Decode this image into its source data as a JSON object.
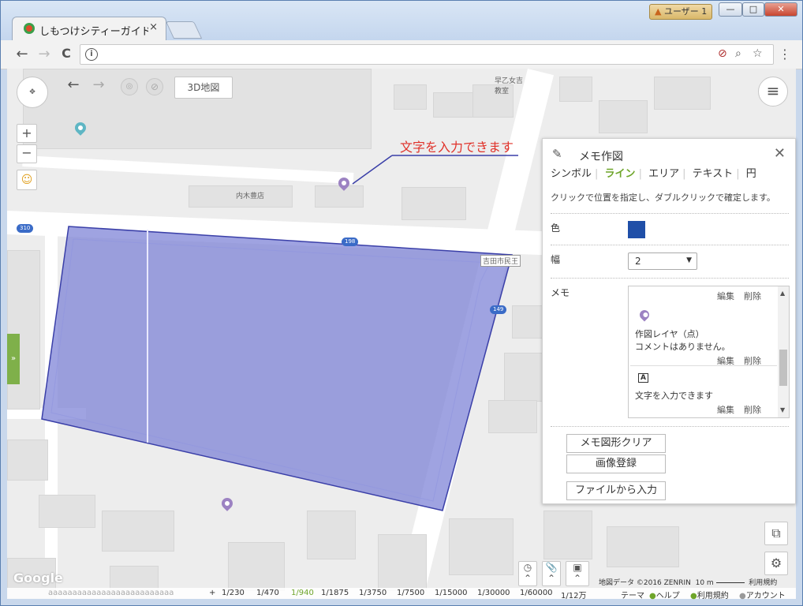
{
  "window": {
    "user_badge": "ユーザー 1",
    "min_label": "—",
    "max_label": "□",
    "close_label": "✕"
  },
  "tab": {
    "title": "しもつけシティーガイド",
    "close": "×"
  },
  "toolbar": {
    "back": "←",
    "forward": "→",
    "reload": "C",
    "info": "i",
    "block_icon": "⊘",
    "zoom_icon": "🔍",
    "star_icon": "☆",
    "menu": "⋮"
  },
  "map_controls": {
    "btn3d": "3D地図",
    "zoom_in": "+",
    "zoom_out": "−",
    "menu_icon": "≡",
    "sidebar_toggle": "»",
    "google": "Google"
  },
  "map_labels": {
    "annotation": "文字を入力できます",
    "store": "内木豊店",
    "facility": "早乙女吉\n教室",
    "route_310": "310",
    "route_198": "198",
    "route_149": "149",
    "city_office": "吉田市民王"
  },
  "panel": {
    "title": "メモ作図",
    "close": "✕",
    "tabs": [
      "シンボル",
      "ライン",
      "エリア",
      "テキスト",
      "円"
    ],
    "active_tab": "ライン",
    "hint": "クリックで位置を指定し、ダブルクリックで確定します。",
    "color_label": "色",
    "color_value": "#1f4fa8",
    "width_label": "幅",
    "width_value": "2",
    "memo_label": "メモ",
    "memo_items": [
      {
        "edit": "編集",
        "delete": "削除"
      },
      {
        "layer": "作図レイヤ（点）",
        "comment": "コメントはありません。",
        "edit": "編集",
        "delete": "削除"
      },
      {
        "text_icon": "A",
        "text": "文字を入力できます",
        "edit": "編集",
        "delete": "削除"
      }
    ],
    "buttons": [
      "メモ図形クリア",
      "画像登録",
      "ファイルから入力"
    ]
  },
  "bottom": {
    "attribution": "地図データ ©2016 ZENRIN",
    "scale_text": "10 m",
    "terms": "利用規約",
    "scales": [
      "1/230",
      "1/470",
      "1/940",
      "1/1875",
      "1/3750",
      "1/7500",
      "1/15000",
      "1/30000",
      "1/60000",
      "1/12万"
    ],
    "active_scale": "1/940",
    "plus": "+",
    "theme": "テーマ",
    "help": "ヘルプ",
    "tos": "利用規約",
    "account": "アカウント",
    "placeholder_text": "aaaaaaaaaaaaaaaaaaaaaaaaaa"
  },
  "colors": {
    "polygon_fill": "#7a7fd6",
    "polygon_stroke": "#3a3fa8",
    "accent_green": "#6ea52a",
    "pin_teal": "#5fb6c4",
    "pin_purple": "#9c82c2",
    "annotation_red": "#e0322a"
  }
}
